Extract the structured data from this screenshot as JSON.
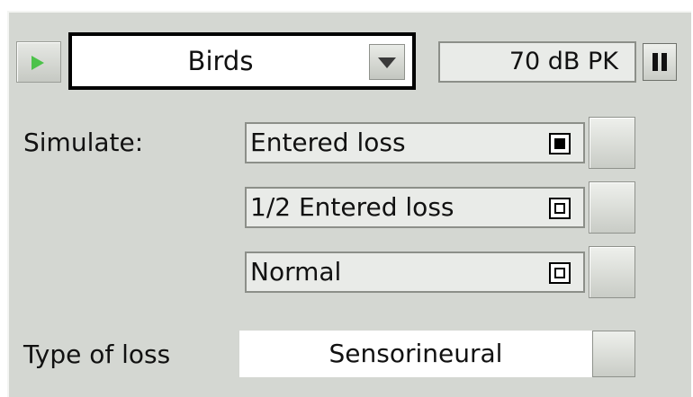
{
  "player": {
    "play_icon": "play-icon",
    "selected_sound": "Birds",
    "dropdown_icon": "chevron-down-icon",
    "level": "70 dB PK",
    "pause_icon": "pause-icon"
  },
  "simulate": {
    "label": "Simulate:",
    "options": [
      {
        "label": "Entered loss",
        "selected": true
      },
      {
        "label": "1/2 Entered loss",
        "selected": false
      },
      {
        "label": "Normal",
        "selected": false
      }
    ]
  },
  "loss_type": {
    "label": "Type of loss",
    "value": "Sensorineural"
  },
  "colors": {
    "panel_bg": "#d4d7d2",
    "play_accent": "#4cc24a"
  }
}
